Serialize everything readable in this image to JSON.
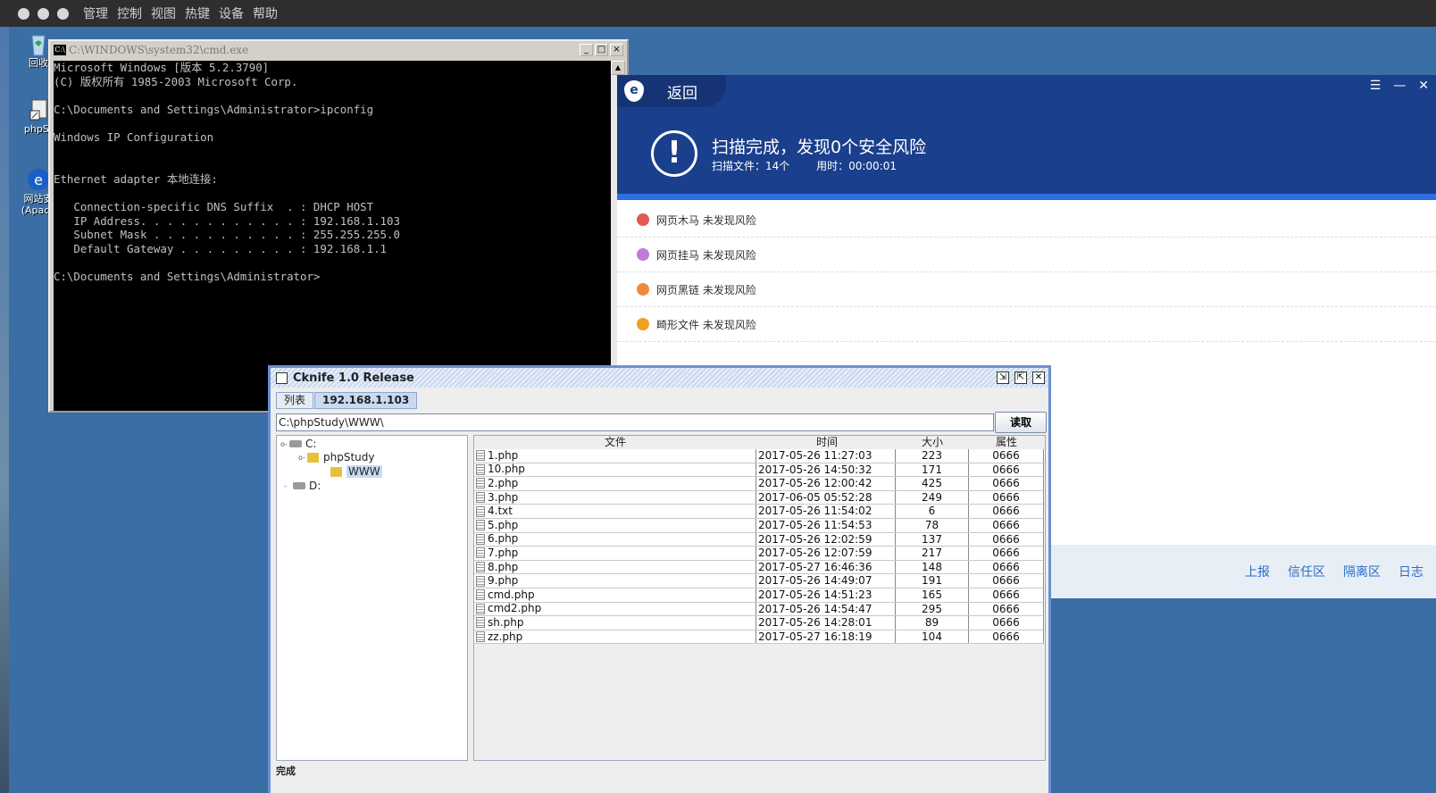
{
  "mac_menu": [
    "管理",
    "控制",
    "视图",
    "热键",
    "设备",
    "帮助"
  ],
  "desktop_icons": [
    {
      "label": "回收"
    },
    {
      "label": "phpSt"
    },
    {
      "label": "网站安",
      "label2": "(Apach"
    }
  ],
  "cmd": {
    "title": "C:\\WINDOWS\\system32\\cmd.exe",
    "icon_text": "C:\\",
    "buttons": [
      "_",
      "□",
      "×"
    ],
    "lines": "Microsoft Windows [版本 5.2.3790]\n(C) 版权所有 1985-2003 Microsoft Corp.\n\nC:\\Documents and Settings\\Administrator>ipconfig\n\nWindows IP Configuration\n\n\nEthernet adapter 本地连接:\n\n   Connection-specific DNS Suffix  . : DHCP HOST\n   IP Address. . . . . . . . . . . . : 192.168.1.103\n   Subnet Mask . . . . . . . . . . . : 255.255.255.0\n   Default Gateway . . . . . . . . . : 192.168.1.1\n\nC:\\Documents and Settings\\Administrator>"
  },
  "scanner": {
    "back_label": "返回",
    "logo": "e",
    "controls": [
      "☰",
      "—",
      "✕"
    ],
    "warn_icon": "!",
    "title": "扫描完成，发现0个安全风险",
    "files_scanned": "扫描文件：14个",
    "time_used": "用时：00:00:01",
    "results": [
      {
        "name": "网页木马",
        "status": "未发现风险",
        "color": "#e05a5a"
      },
      {
        "name": "网页挂马",
        "status": "未发现风险",
        "color": "#c07ad8"
      },
      {
        "name": "网页黑链",
        "status": "未发现风险",
        "color": "#f08a3a"
      },
      {
        "name": "畸形文件",
        "status": "未发现风险",
        "color": "#f0a020"
      }
    ],
    "footer_links": [
      "上报",
      "信任区",
      "隔离区",
      "日志"
    ]
  },
  "cknife": {
    "title": "Cknife 1.0 Release",
    "tabs": [
      "列表",
      "192.168.1.103"
    ],
    "path": "C:\\phpStudy\\WWW\\",
    "read_button": "读取",
    "tree": {
      "c": "C:",
      "phpstudy": "phpStudy",
      "www": "WWW",
      "d": "D:"
    },
    "columns": [
      "文件",
      "时间",
      "大小",
      "属性"
    ],
    "files": [
      {
        "name": "1.php",
        "time": "2017-05-26 11:27:03",
        "size": "223",
        "attr": "0666"
      },
      {
        "name": "10.php",
        "time": "2017-05-26 14:50:32",
        "size": "171",
        "attr": "0666"
      },
      {
        "name": "2.php",
        "time": "2017-05-26 12:00:42",
        "size": "425",
        "attr": "0666"
      },
      {
        "name": "3.php",
        "time": "2017-06-05 05:52:28",
        "size": "249",
        "attr": "0666"
      },
      {
        "name": "4.txt",
        "time": "2017-05-26 11:54:02",
        "size": "6",
        "attr": "0666"
      },
      {
        "name": "5.php",
        "time": "2017-05-26 11:54:53",
        "size": "78",
        "attr": "0666"
      },
      {
        "name": "6.php",
        "time": "2017-05-26 12:02:59",
        "size": "137",
        "attr": "0666"
      },
      {
        "name": "7.php",
        "time": "2017-05-26 12:07:59",
        "size": "217",
        "attr": "0666"
      },
      {
        "name": "8.php",
        "time": "2017-05-27 16:46:36",
        "size": "148",
        "attr": "0666"
      },
      {
        "name": "9.php",
        "time": "2017-05-26 14:49:07",
        "size": "191",
        "attr": "0666"
      },
      {
        "name": "cmd.php",
        "time": "2017-05-26 14:51:23",
        "size": "165",
        "attr": "0666"
      },
      {
        "name": "cmd2.php",
        "time": "2017-05-26 14:54:47",
        "size": "295",
        "attr": "0666"
      },
      {
        "name": "sh.php",
        "time": "2017-05-26 14:28:01",
        "size": "89",
        "attr": "0666"
      },
      {
        "name": "zz.php",
        "time": "2017-05-27 16:18:19",
        "size": "104",
        "attr": "0666"
      }
    ],
    "status": "完成"
  }
}
